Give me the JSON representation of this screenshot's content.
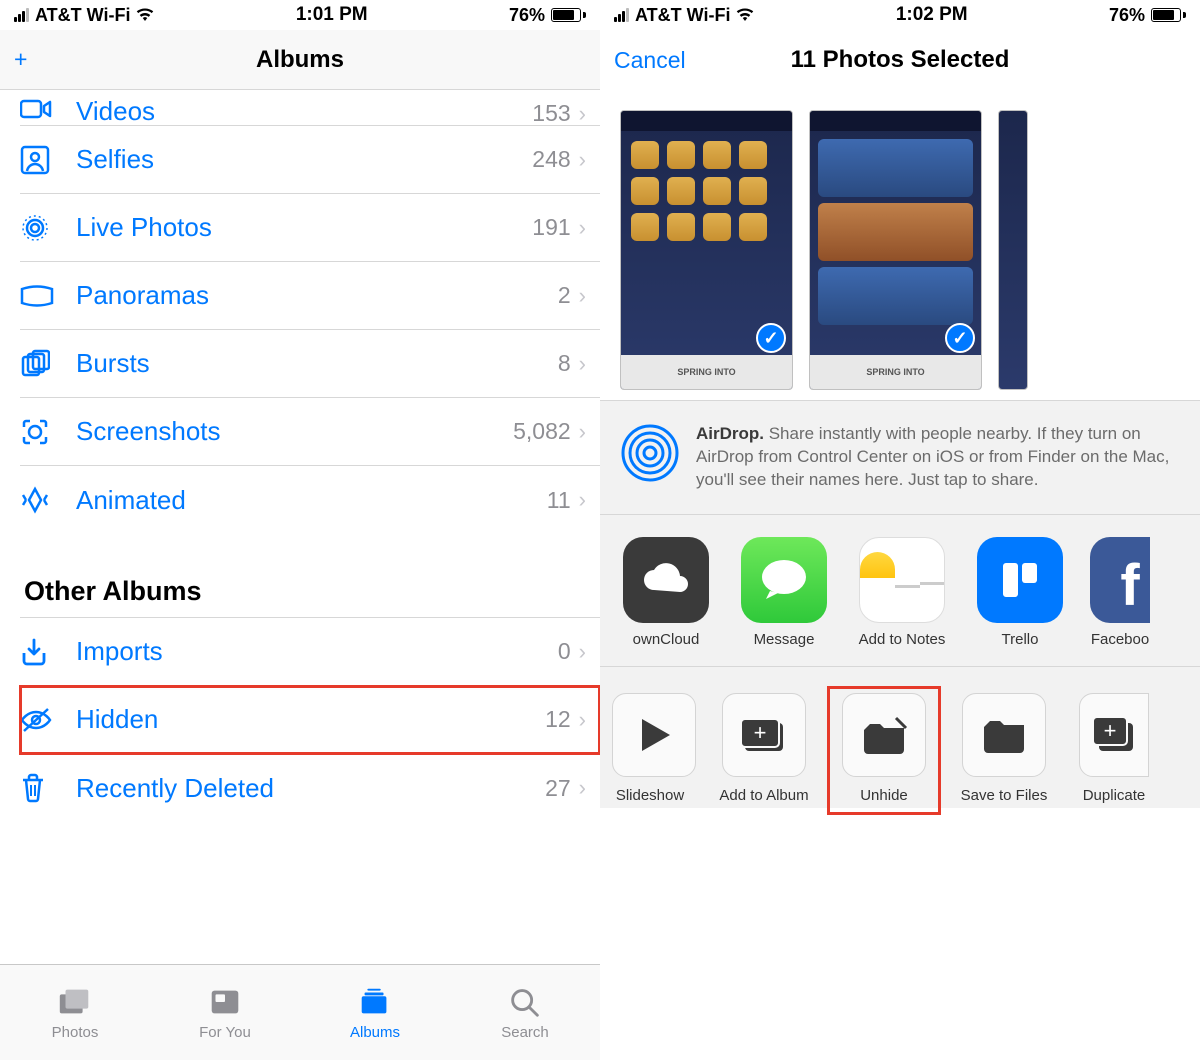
{
  "left": {
    "status": {
      "carrier": "AT&T Wi-Fi",
      "time": "1:01 PM",
      "battery": "76%"
    },
    "nav": {
      "title": "Albums",
      "add": "+"
    },
    "albums": [
      {
        "icon": "video",
        "label": "Videos",
        "count": "153"
      },
      {
        "icon": "selfie",
        "label": "Selfies",
        "count": "248"
      },
      {
        "icon": "live",
        "label": "Live Photos",
        "count": "191"
      },
      {
        "icon": "pano",
        "label": "Panoramas",
        "count": "2"
      },
      {
        "icon": "burst",
        "label": "Bursts",
        "count": "8"
      },
      {
        "icon": "screenshot",
        "label": "Screenshots",
        "count": "5,082"
      },
      {
        "icon": "animated",
        "label": "Animated",
        "count": "11"
      }
    ],
    "other_heading": "Other Albums",
    "other": [
      {
        "icon": "import",
        "label": "Imports",
        "count": "0"
      },
      {
        "icon": "hidden",
        "label": "Hidden",
        "count": "12",
        "hl": true
      },
      {
        "icon": "trash",
        "label": "Recently Deleted",
        "count": "27"
      }
    ],
    "tabs": {
      "photos": "Photos",
      "foryou": "For You",
      "albums": "Albums",
      "search": "Search"
    }
  },
  "right": {
    "status": {
      "carrier": "AT&T Wi-Fi",
      "time": "1:02 PM",
      "battery": "76%"
    },
    "nav": {
      "cancel": "Cancel",
      "title": "11 Photos Selected"
    },
    "airdrop": {
      "bold": "AirDrop.",
      "text": " Share instantly with people nearby. If they turn on AirDrop from Control Center on iOS or from Finder on the Mac, you'll see their names here. Just tap to share."
    },
    "apps": [
      {
        "label": "ownCloud",
        "bg": "#3a3a3a"
      },
      {
        "label": "Message",
        "bg": "#4cd964"
      },
      {
        "label": "Add to Notes",
        "bg": "#ffffff"
      },
      {
        "label": "Trello",
        "bg": "#0079ff"
      },
      {
        "label": "Faceboo",
        "bg": "#3b5998"
      }
    ],
    "actions": [
      {
        "label": "Slideshow",
        "icon": "play"
      },
      {
        "label": "Add to Album",
        "icon": "folderplus"
      },
      {
        "label": "Unhide",
        "icon": "unhide",
        "hl": true
      },
      {
        "label": "Save to Files",
        "icon": "folder"
      },
      {
        "label": "Duplicate",
        "icon": "dup"
      }
    ]
  }
}
